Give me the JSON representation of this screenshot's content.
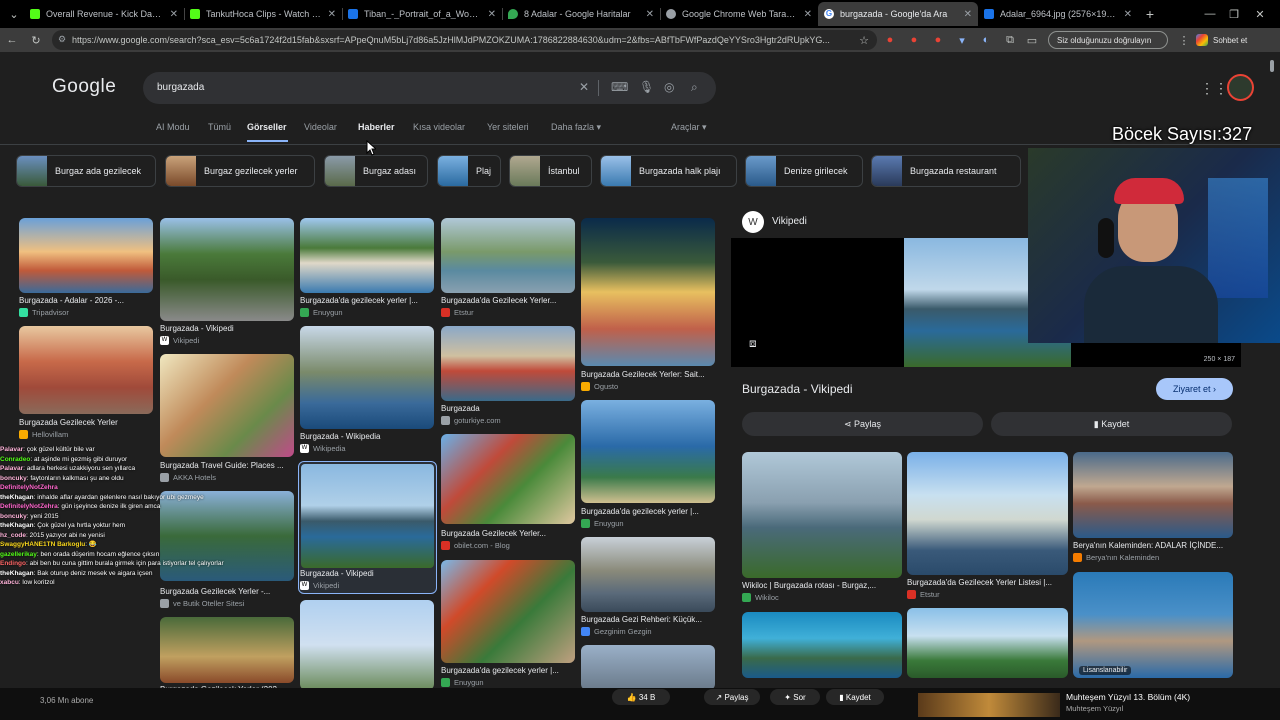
{
  "tabs": [
    {
      "title": "Overall Revenue - Kick Dashboard",
      "color": "#53fc18"
    },
    {
      "title": "TankutHoca Clips - Watch Live on...",
      "color": "#53fc18"
    },
    {
      "title": "Tiban_-_Portrait_of_a_Woman_(L...",
      "color": "#1a73e8"
    },
    {
      "title": "8 Adalar - Google Haritalar",
      "color": "#34a853"
    },
    {
      "title": "Google Chrome Web Tarayıcısı",
      "color": "#9aa0a6"
    },
    {
      "title": "burgazada - Google'da Ara",
      "color": "#4285f4",
      "active": true
    },
    {
      "title": "Adalar_6964.jpg (2576×1932)",
      "color": "#1a73e8"
    }
  ],
  "browser": {
    "url": "https://www.google.com/search?sca_esv=5c6a1724f2d15fab&sxsrf=APpeQnuM5bLj7d86a5JzHlMJdPMZOKZUMA:1786822884630&udm=2&fbs=ABfTbFWfPazdQeYYSro3Hgtr2dRUpkYG...",
    "verify_pill": "Siz olduğunuzu doğrulayın",
    "chat_pill": "Sohbet et"
  },
  "google": {
    "logo": "Google",
    "query": "burgazada",
    "nav": [
      "AI Modu",
      "Tümü",
      "Görseller",
      "Videolar",
      "Haberler",
      "Kısa videolar",
      "Yer siteleri",
      "Daha fazla"
    ],
    "tools": "Araçlar"
  },
  "chips": [
    "Burgaz ada gezilecek",
    "Burgaz gezilecek yerler",
    "Burgaz adası",
    "Plaj",
    "İstanbul",
    "Burgazada halk plajı",
    "Denize girilecek",
    "Burgazada restaurant"
  ],
  "results": {
    "c1": [
      {
        "caption": "Burgazada - Adalar - 2026 -...",
        "source": "Tripadvisor",
        "fav": "#34e0a1"
      },
      {
        "caption": "Burgazada Gezilecek Yerler",
        "source": "Hellovillam",
        "fav": "#f9ab00"
      },
      {
        "caption": "Burgazada Gezilecek Yerler (202...",
        "source": ""
      }
    ],
    "c2": [
      {
        "caption": "Burgazada - Vikipedi",
        "source": "Vikipedi",
        "fav": "#ffffff"
      },
      {
        "caption": "Burgazada Travel Guide: Places ...",
        "source": "AKKA Hotels",
        "fav": "#9aa0a6"
      },
      {
        "caption": "Burgazada Gezilecek Yerler -...",
        "source": "ve Butik Oteller Sitesi",
        "fav": "#9aa0a6"
      }
    ],
    "c3": [
      {
        "caption": "Burgazada'da gezilecek yerler |...",
        "source": "Enuygun",
        "fav": "#34a853"
      },
      {
        "caption": "Burgazada - Wikipedia",
        "source": "Wikipedia",
        "fav": "#ffffff"
      },
      {
        "caption": "Burgazada - Vikipedi",
        "source": "Vikipedi",
        "fav": "#ffffff"
      }
    ],
    "c4": [
      {
        "caption": "Burgazada'da Gezilecek Yerler...",
        "source": "Etstur",
        "fav": "#d93025"
      },
      {
        "caption": "Burgazada",
        "source": "goturkiye.com",
        "fav": "#9aa0a6"
      },
      {
        "caption": "Burgazada Gezilecek Yerler...",
        "source": "obilet.com - Blog",
        "fav": "#d93025"
      },
      {
        "caption": "Burgazada'da gezilecek yerler |...",
        "source": "Enuygun",
        "fav": "#34a853"
      }
    ],
    "c5": [
      {
        "caption": "Burgazada Gezilecek Yerler: Sait...",
        "source": "Ogusto",
        "fav": "#f9ab00"
      },
      {
        "caption": "Burgazada'da gezilecek yerler |...",
        "source": "Enuygun",
        "fav": "#34a853"
      },
      {
        "caption": "Burgazada Gezi Rehberi: Küçük...",
        "source": "Gezginim Gezgin",
        "fav": "#4285f4"
      }
    ]
  },
  "panel": {
    "site": "Vikipedi",
    "size": "250 × 187",
    "title": "Burgazada - Vikipedi",
    "visit": "Ziyaret et",
    "share": "Paylaş",
    "save": "Kaydet",
    "related": [
      {
        "caption": "Wikiloc | Burgazada rotası - Burgaz,...",
        "source": "Wikiloc"
      },
      {
        "caption": "Burgazada'da Gezilecek Yerler Listesi |...",
        "source": "Etstur"
      },
      {
        "caption": "Berya'nın Kaleminden: ADALAR İÇİNDE...",
        "source": "Berya'nın Kaleminden"
      },
      {
        "caption": "",
        "source": "Lisanslanabilir"
      }
    ]
  },
  "overlay": {
    "counter": "Böcek Sayısı:327",
    "chat": [
      {
        "user": "Palavar",
        "msg": ": çok güzel kültür bile var",
        "color": "#ffb3d9"
      },
      {
        "user": "Conradeo",
        "msg": ": at aşinde mi gezmiş gibi duruyor",
        "color": "#53fc18"
      },
      {
        "user": "Palavar",
        "msg": ": adlara herkesi uzakkiyoru sen yıllarca",
        "color": "#ffb3d9"
      },
      {
        "user": "boncuky",
        "msg": ": faytonların kalkması şu ane oldu",
        "color": "#ffb3d9"
      },
      {
        "user": "DefinitelyNotZehra",
        "msg": "",
        "color": "#ff66cc"
      },
      {
        "user": "theKhagan",
        "msg": ": inhalde aflar ayardan gelenlere nasıl bakıyor ubi gezmeye",
        "color": "#ffffff"
      },
      {
        "user": "DefinitelyNotZehra",
        "msg": ": gün işeyince denize ilk giren amca",
        "color": "#ff66cc"
      },
      {
        "user": "boncuky",
        "msg": ": yeni 2015",
        "color": "#ffb3d9"
      },
      {
        "user": "theKhagan",
        "msg": ": Çok güzel ya hırtla yoktur hem",
        "color": "#ffffff"
      },
      {
        "user": "hz_code",
        "msg": ": 2015 yazıyor abi ne yenisi",
        "color": "#ffb3d9"
      },
      {
        "user": "SwaggyHANE1TN Barkoglu",
        "msg": ": 😂",
        "color": "#f9d71c"
      },
      {
        "user": "gazellerikay",
        "msg": ": ben orada düşerim hocam eğlence çıksın",
        "color": "#53fc18"
      },
      {
        "user": "Endingo",
        "msg": ": abi ben bu cuna gittim burala girmek için para istiyorlar tel çalıyorlar",
        "color": "#ff6666"
      },
      {
        "user": "theKhagan",
        "msg": ": Bak oturup deniz mesek ve aigara içsen",
        "color": "#ffffff"
      },
      {
        "user": "xabcu",
        "msg": ": low koritzol",
        "color": "#ffb3d9"
      }
    ],
    "bottom": {
      "subs": "3,06 Mn abone",
      "likes": "34 B",
      "share": "Paylaş",
      "ask": "Sor",
      "save": "Kaydet",
      "video_title": "Muhteşem Yüzyıl 13. Bölüm (4K)",
      "video_channel": "Muhteşem Yüzyıl"
    }
  }
}
